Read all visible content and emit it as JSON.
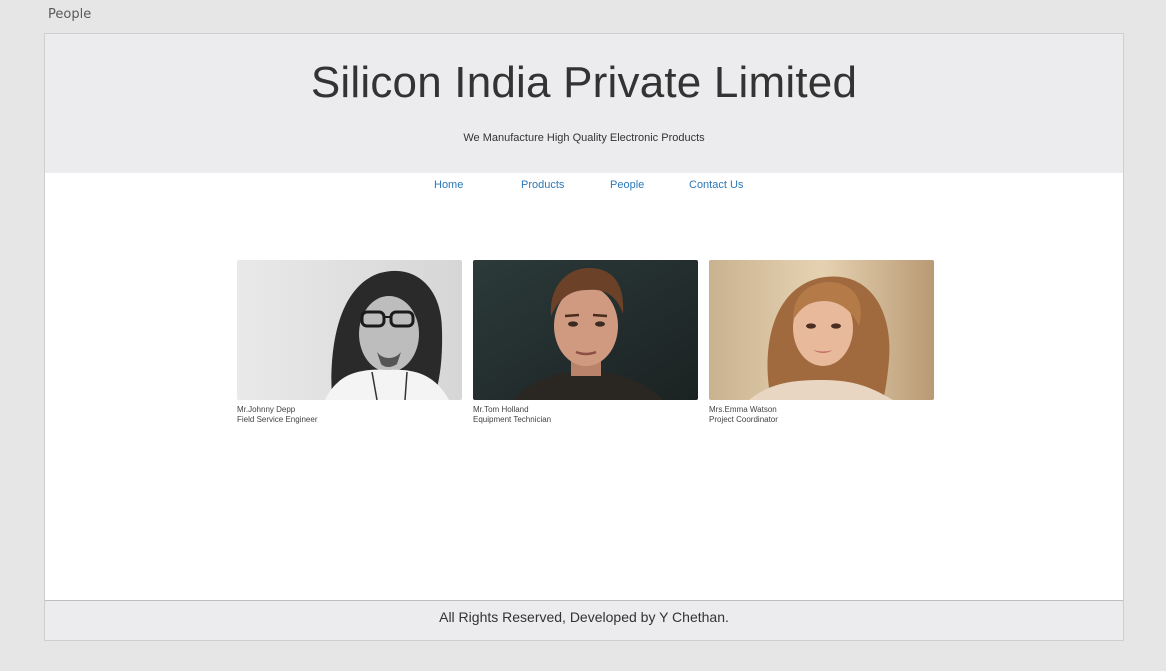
{
  "artboard": {
    "label": "People"
  },
  "header": {
    "title": "Silicon India Private Limited",
    "tagline": "We Manufacture High Quality Electronic Products"
  },
  "nav": {
    "items": [
      {
        "label": "Home"
      },
      {
        "label": "Products"
      },
      {
        "label": "People"
      },
      {
        "label": "Contact Us"
      }
    ]
  },
  "people": [
    {
      "name": "Mr.Johnny Depp",
      "role": "Field Service Engineer"
    },
    {
      "name": "Mr.Tom Holland",
      "role": "Equipment Technician"
    },
    {
      "name": "Mrs.Emma Watson",
      "role": "Project Coordinator"
    }
  ],
  "footer": {
    "text": "All Rights Reserved, Developed by Y Chethan."
  },
  "colors": {
    "page_background": "#e6e6e6",
    "header_background": "#ececee",
    "nav_link": "#2b78b8",
    "text": "#333333"
  }
}
